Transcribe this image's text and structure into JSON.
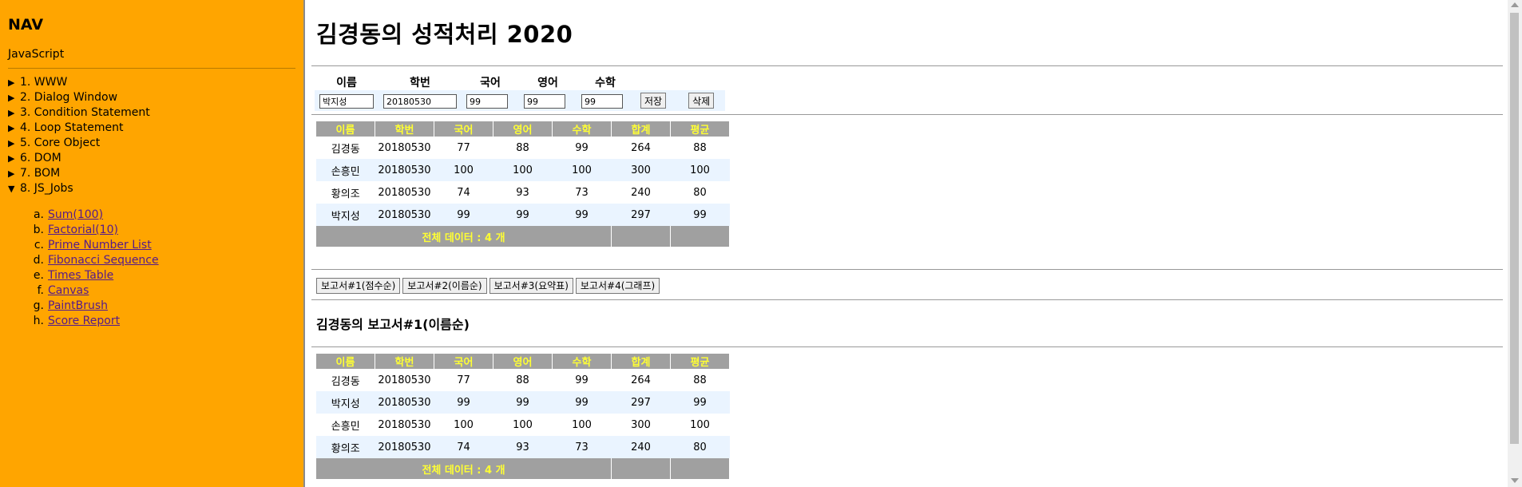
{
  "sidebar": {
    "title": "NAV",
    "subtitle": "JavaScript",
    "items": [
      {
        "label": "1. WWW",
        "expanded": false
      },
      {
        "label": "2. Dialog Window",
        "expanded": false
      },
      {
        "label": "3. Condition Statement",
        "expanded": false
      },
      {
        "label": "4. Loop Statement",
        "expanded": false
      },
      {
        "label": "5. Core Object",
        "expanded": false
      },
      {
        "label": "6. DOM",
        "expanded": false
      },
      {
        "label": "7. BOM",
        "expanded": false
      },
      {
        "label": "8. JS_Jobs",
        "expanded": true
      }
    ],
    "subitems": [
      {
        "letter": "a.",
        "label": "Sum(100)"
      },
      {
        "letter": "b.",
        "label": "Factorial(10)"
      },
      {
        "letter": "c.",
        "label": "Prime Number List"
      },
      {
        "letter": "d.",
        "label": "Fibonacci Sequence"
      },
      {
        "letter": "e.",
        "label": "Times Table"
      },
      {
        "letter": "f.",
        "label": "Canvas"
      },
      {
        "letter": "g.",
        "label": "PaintBrush"
      },
      {
        "letter": "h.",
        "label": "Score Report"
      }
    ]
  },
  "main": {
    "title": "김경동의 성적처리 2020",
    "form": {
      "headers": [
        "이름",
        "학번",
        "국어",
        "영어",
        "수학"
      ],
      "values": {
        "name": "박지성",
        "id": "20180530",
        "korean": "99",
        "english": "99",
        "math": "99"
      },
      "save_label": "저장",
      "delete_label": "삭제"
    },
    "table_headers": [
      "이름",
      "학번",
      "국어",
      "영어",
      "수학",
      "합계",
      "평균"
    ],
    "rows": [
      [
        "김경동",
        "20180530",
        "77",
        "88",
        "99",
        "264",
        "88"
      ],
      [
        "손흥민",
        "20180530",
        "100",
        "100",
        "100",
        "300",
        "100"
      ],
      [
        "황의조",
        "20180530",
        "74",
        "93",
        "73",
        "240",
        "80"
      ],
      [
        "박지성",
        "20180530",
        "99",
        "99",
        "99",
        "297",
        "99"
      ]
    ],
    "footer_text": "전체 데이터 : 4 개",
    "report_buttons": [
      "보고서#1(점수순)",
      "보고서#2(이름순)",
      "보고서#3(요약표)",
      "보고서#4(그래프)"
    ],
    "report_title": "김경동의 보고서#1(이름순)",
    "report_rows": [
      [
        "김경동",
        "20180530",
        "77",
        "88",
        "99",
        "264",
        "88"
      ],
      [
        "박지성",
        "20180530",
        "99",
        "99",
        "99",
        "297",
        "99"
      ],
      [
        "손흥민",
        "20180530",
        "100",
        "100",
        "100",
        "300",
        "100"
      ],
      [
        "황의조",
        "20180530",
        "74",
        "93",
        "73",
        "240",
        "80"
      ]
    ],
    "report_footer_text": "전체 데이터 : 4 개"
  },
  "colors": {
    "sidebar_bg": "#ffa500",
    "header_bg": "#a0a0a0",
    "header_text": "#ffff33",
    "alt_row": "#eaf4ff",
    "link": "#551a8b"
  }
}
